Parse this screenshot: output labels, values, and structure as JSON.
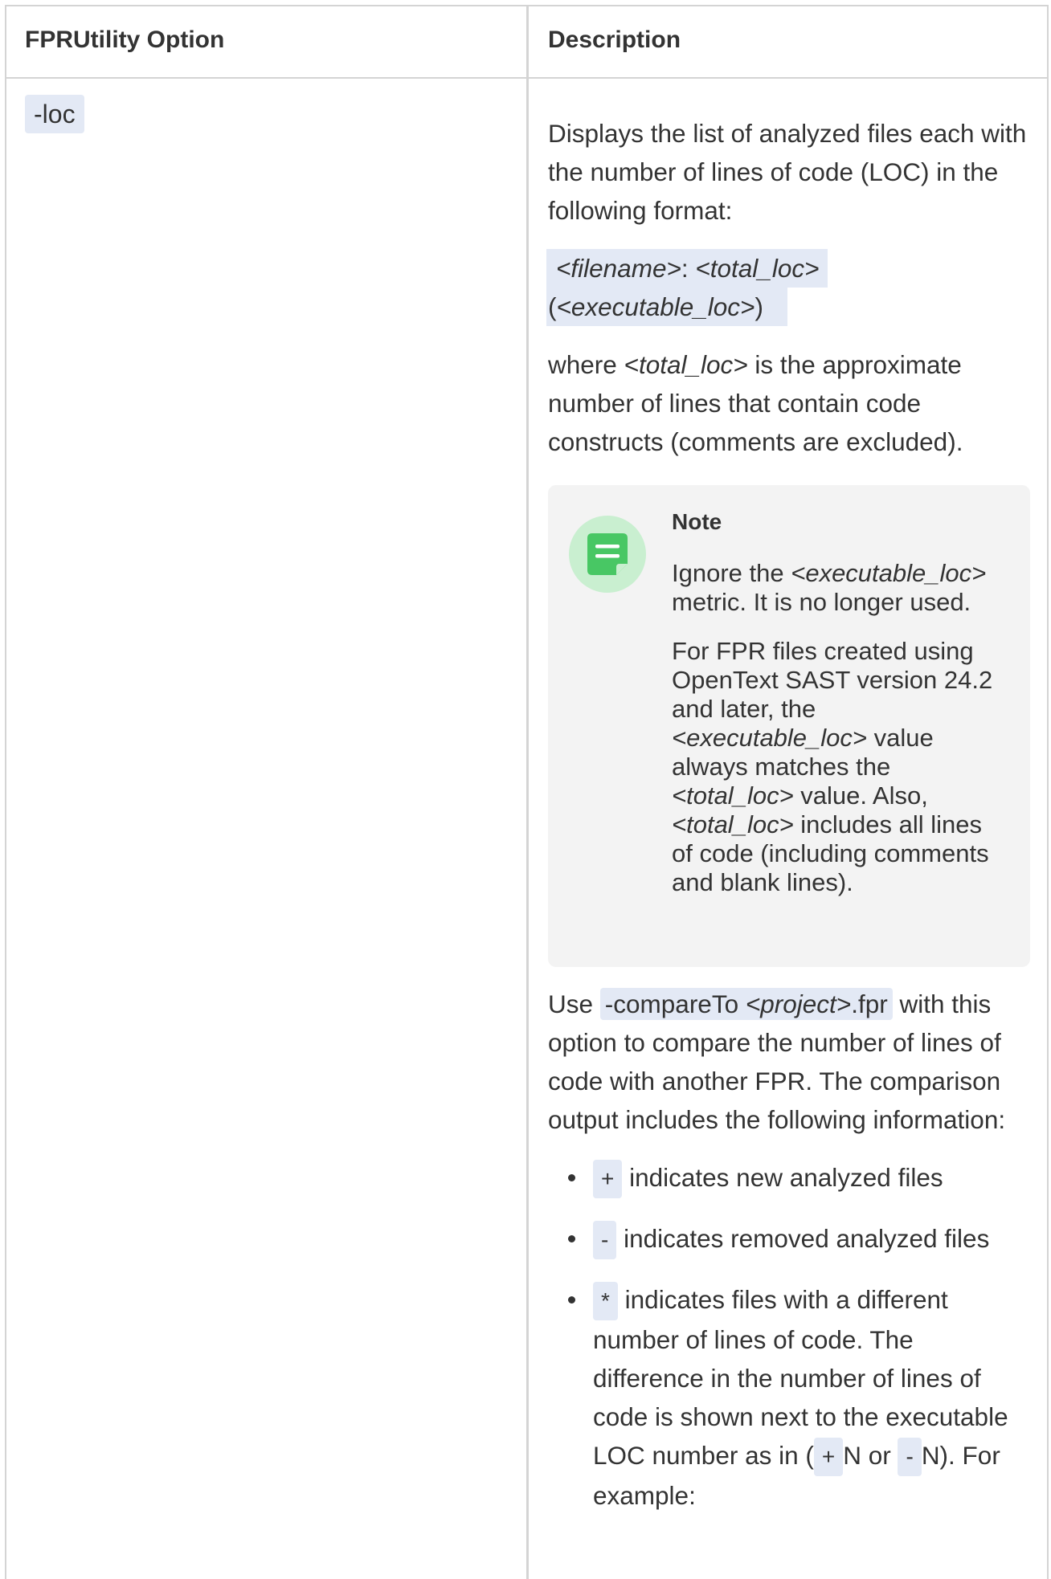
{
  "table": {
    "headers": {
      "option": "FPRUtility Option",
      "description": "Description"
    },
    "row": {
      "option": "-loc",
      "desc_intro": "Displays the list of analyzed files each with the number of lines of code (LOC) in the following format:",
      "format_filename": "<filename>",
      "format_colon": ": ",
      "format_total": "<total_loc>",
      "format_open": "(",
      "format_exec": "<executable_loc>",
      "format_close": ")",
      "where_prefix": "where ",
      "where_total": "<total_loc>",
      "where_suffix": " is the approximate number of lines that contain code constructs (comments are excluded).",
      "note": {
        "title": "Note",
        "icon": "note-icon",
        "p1_prefix": "Ignore the ",
        "p1_exec": "<executable_loc>",
        "p1_suffix": " metric. It is no longer used.",
        "p2_a": "For FPR files created using OpenText SAST version 24.2 and later, the ",
        "p2_exec": "<executable_loc>",
        "p2_b": " value always matches the ",
        "p2_total1": "<total_loc>",
        "p2_c": " value. Also, ",
        "p2_total2": "<total_loc>",
        "p2_d": " includes all lines of code (including comments and blank lines)."
      },
      "use_prefix": "Use ",
      "compare_opt": "-compareTo ",
      "compare_project": "<project>",
      "compare_ext": ".fpr",
      "use_suffix": " with this option to compare the number of lines of code with another FPR. The comparison output includes the following information:",
      "bullets": [
        {
          "symbol": "+",
          "text": " indicates new analyzed files"
        },
        {
          "symbol": "-",
          "text": " indicates removed analyzed files"
        },
        {
          "symbol": "*",
          "text": " indicates files with a different number of lines of code. The difference in the number of lines of code is shown next to the executable LOC number as in (",
          "plus": "+",
          "n1": "N or ",
          "minus": "-",
          "n2": "N). For example:"
        }
      ]
    }
  },
  "colors": {
    "code_bg": "#e3e9f5",
    "note_bg": "#f3f3f3",
    "note_icon_green": "#48c764",
    "border": "#d4d4d4"
  }
}
